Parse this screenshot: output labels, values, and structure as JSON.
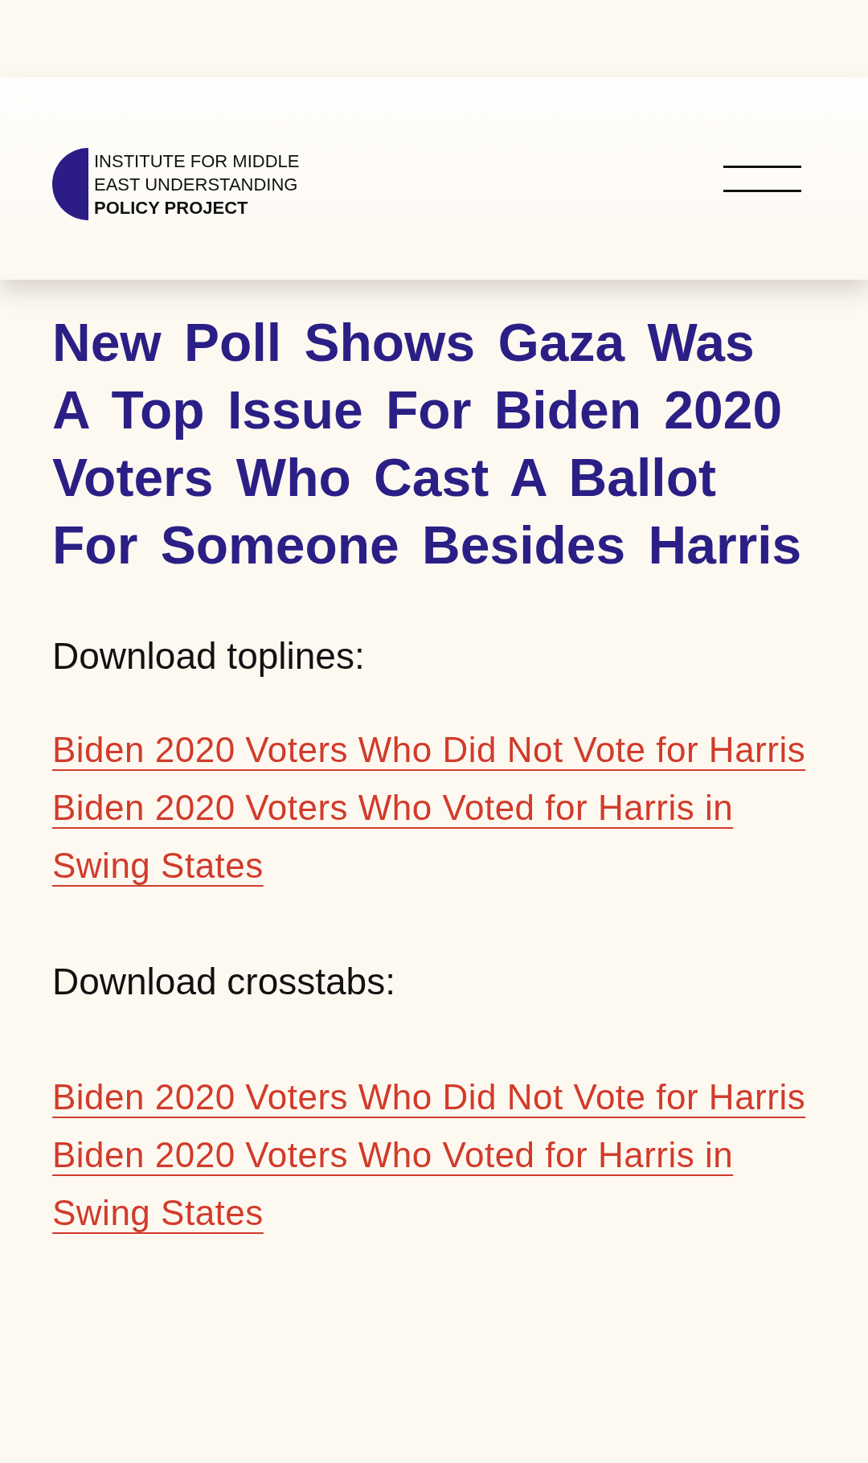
{
  "header": {
    "logo": {
      "organization": "INSTITUTE FOR MIDDLE EAST UNDERSTANDING",
      "project": "POLICY PROJECT"
    }
  },
  "article": {
    "title": "New Poll Shows Gaza Was A Top Issue For Biden 2020 Voters Who Cast A Ballot For Someone Besides Harris",
    "sections": [
      {
        "label": "Download toplines:",
        "links": [
          "Biden 2020 Voters Who Did Not Vote for Harris",
          "Biden 2020 Voters Who Voted for Harris in Swing States"
        ]
      },
      {
        "label": "Download crosstabs:",
        "links": [
          "Biden 2020 Voters Who Did Not Vote for Harris",
          "Biden 2020 Voters Who Voted for Harris in Swing States"
        ]
      }
    ]
  }
}
